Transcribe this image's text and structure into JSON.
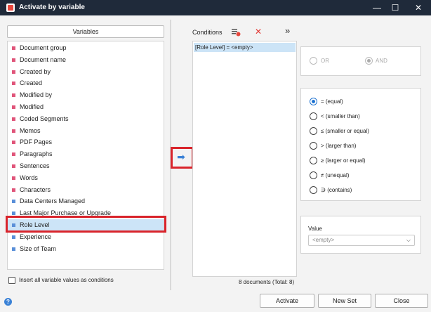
{
  "window": {
    "title": "Activate by variable",
    "minimize": "—",
    "maximize": "☐",
    "close": "✕"
  },
  "variables_button": "Variables",
  "variables": [
    {
      "label": "Document group",
      "color": "#e0557a"
    },
    {
      "label": "Document name",
      "color": "#e0557a"
    },
    {
      "label": "Created by",
      "color": "#e0557a"
    },
    {
      "label": "Created",
      "color": "#e0557a"
    },
    {
      "label": "Modified by",
      "color": "#e0557a"
    },
    {
      "label": "Modified",
      "color": "#e0557a"
    },
    {
      "label": "Coded Segments",
      "color": "#e0557a"
    },
    {
      "label": "Memos",
      "color": "#e0557a"
    },
    {
      "label": "PDF Pages",
      "color": "#e0557a"
    },
    {
      "label": "Paragraphs",
      "color": "#e0557a"
    },
    {
      "label": "Sentences",
      "color": "#e0557a"
    },
    {
      "label": "Words",
      "color": "#e0557a"
    },
    {
      "label": "Characters",
      "color": "#e0557a"
    },
    {
      "label": "Data Centers Managed",
      "color": "#5a8fd8"
    },
    {
      "label": "Last Major Purchase or Upgrade",
      "color": "#5a8fd8"
    },
    {
      "label": "Role Level",
      "color": "#5a8fd8"
    },
    {
      "label": "Experience",
      "color": "#5a8fd8"
    },
    {
      "label": "Size of Team",
      "color": "#5a8fd8"
    }
  ],
  "selected_variable_index": 15,
  "insert_all_label": "Insert all variable values as conditions",
  "conditions": {
    "label": "Conditions",
    "items": [
      "[Role Level] = <empty>"
    ],
    "status": "8 documents (Total: 8)"
  },
  "logic": {
    "or_label": "OR",
    "and_label": "AND",
    "selected": "AND"
  },
  "operators": [
    {
      "label": "= (equal)",
      "checked": true
    },
    {
      "label": "< (smaller than)",
      "checked": false
    },
    {
      "label": "≤ (smaller or equal)",
      "checked": false
    },
    {
      "label": "> (larger than)",
      "checked": false
    },
    {
      "label": "≥ (larger or equal)",
      "checked": false
    },
    {
      "label": "≠ (unequal)",
      "checked": false
    },
    {
      "label": "∋ (contains)",
      "checked": false
    }
  ],
  "value": {
    "label": "Value",
    "current": "<empty>"
  },
  "buttons": {
    "activate": "Activate",
    "new_set": "New Set",
    "close": "Close"
  },
  "icons": {
    "arrow": "➡",
    "expand": "»",
    "delete": "✕",
    "help": "?",
    "chevron": "⌵"
  },
  "colors": {
    "accent": "#1f73d1",
    "highlight": "#d9242b",
    "selection": "#cce4f7"
  }
}
